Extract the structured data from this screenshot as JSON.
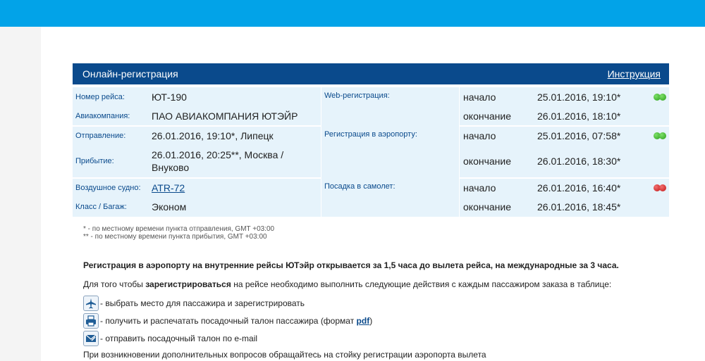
{
  "panel": {
    "title": "Онлайн-регистрация",
    "instruction_link": "Инструкция"
  },
  "flight": {
    "number_label": "Номер рейса:",
    "number": "ЮТ-190",
    "airline_label": "Авиакомпания:",
    "airline": "ПАО АВИАКОМПАНИЯ ЮТЭЙР",
    "departure_label": "Отправление:",
    "departure": "26.01.2016, 19:10*, Липецк",
    "arrival_label": "Прибытие:",
    "arrival": "26.01.2016, 20:25**, Москва / Внуково",
    "aircraft_label": "Воздушное судно:",
    "aircraft": "ATR-72",
    "class_label": "Класс / Багаж:",
    "class": "Эконом"
  },
  "schedule": [
    {
      "label": "Web-регистрация:",
      "status": "open",
      "rows": [
        {
          "phase": "начало",
          "date": "25.01.2016, 19:10*"
        },
        {
          "phase": "окончание",
          "date": "26.01.2016, 18:10*"
        }
      ]
    },
    {
      "label": "Регистрация в аэропорту:",
      "status": "open",
      "rows": [
        {
          "phase": "начало",
          "date": "25.01.2016, 07:58*"
        },
        {
          "phase": "окончание",
          "date": "26.01.2016, 18:30*"
        }
      ]
    },
    {
      "label": "Посадка в самолет:",
      "status": "closed",
      "rows": [
        {
          "phase": "начало",
          "date": "26.01.2016, 16:40*"
        },
        {
          "phase": "окончание",
          "date": "26.01.2016, 18:45*"
        }
      ]
    }
  ],
  "notes": {
    "one_star": "* - по местному времени пункта отправления, GMT +03:00",
    "two_star": "** - по местному времени пункта прибытия, GMT +03:00"
  },
  "info": {
    "airport_notice": "Регистрация в аэропорту на внутренние рейсы ЮТэйр открывается за 1,5 часа до вылета рейса, на международные за 3 часа.",
    "instr_prefix": "Для того чтобы ",
    "instr_bold": "зарегистрироваться",
    "instr_suffix": " на рейсе необходимо выполнить следующие действия с каждым пассажиром заказа в таблице:",
    "action_seat": "- выбрать место для пассажира и зарегистрировать",
    "action_print_prefix": "- получить и распечатать посадочный талон пассажира (формат ",
    "action_print_link": "pdf",
    "action_print_suffix": ")",
    "action_email": "- отправить посадочный талон по e-mail",
    "footer": "При возникновении дополнительных вопросов обращайтесь на стойку регистрации аэропорта вылета"
  },
  "colors": {
    "topbar": "#02a3e8",
    "header": "#0a4a8c",
    "open": "#2a9f18",
    "closed": "#c21414"
  }
}
